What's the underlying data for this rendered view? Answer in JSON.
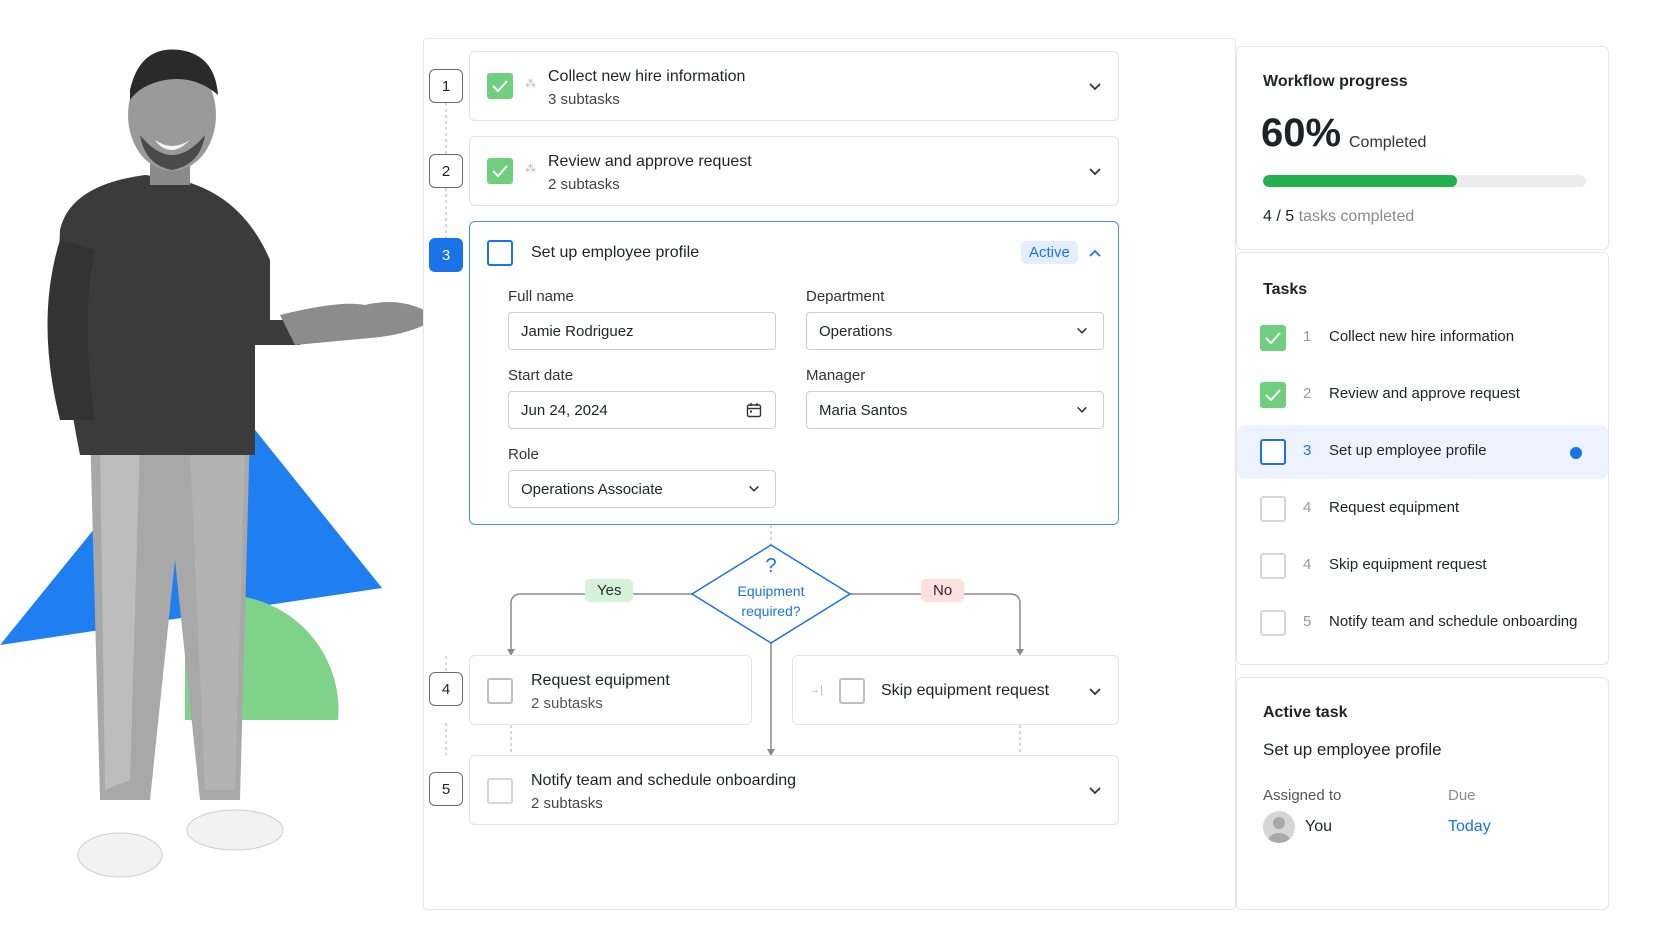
{
  "workflow": {
    "steps": [
      {
        "num": "1",
        "title": "Collect new hire information",
        "subtitle": "3 subtasks",
        "status": "done"
      },
      {
        "num": "2",
        "title": "Review and approve request",
        "subtitle": "2 subtasks",
        "status": "done"
      },
      {
        "num": "3",
        "title": "Set up employee profile",
        "badge": "Active",
        "status": "active"
      },
      {
        "num": "4",
        "title": "Request equipment",
        "subtitle": "2 subtasks",
        "status": "todo"
      },
      {
        "num": "5",
        "title": "Notify team and schedule onboarding",
        "subtitle": "2 subtasks",
        "status": "todo"
      }
    ],
    "skip_step": {
      "title": "Skip equipment request"
    },
    "form": {
      "full_name_label": "Full name",
      "full_name_value": "Jamie Rodriguez",
      "department_label": "Department",
      "department_value": "Operations",
      "start_date_label": "Start date",
      "start_date_value": "Jun 24, 2024",
      "manager_label": "Manager",
      "manager_value": "Maria Santos",
      "role_label": "Role",
      "role_value": "Operations Associate"
    },
    "decision": {
      "symbol": "?",
      "line1": "Equipment",
      "line2": "required?",
      "yes": "Yes",
      "no": "No"
    }
  },
  "progress": {
    "title": "Workflow progress",
    "percent_text": "60%",
    "percent_label": "Completed",
    "percent_value": 0.6,
    "completed": "4",
    "total": "5",
    "count_sep": "/",
    "count_suffix": "tasks completed"
  },
  "tasks": {
    "title": "Tasks",
    "items": [
      {
        "num": "1",
        "label": "Collect new hire information",
        "status": "done"
      },
      {
        "num": "2",
        "label": "Review and approve request",
        "status": "done"
      },
      {
        "num": "3",
        "label": "Set up employee profile",
        "status": "active"
      },
      {
        "num": "4",
        "label": "Request equipment",
        "status": "todo"
      },
      {
        "num": "4",
        "label": "Skip equipment request",
        "status": "todo"
      },
      {
        "num": "5",
        "label": "Notify team and schedule onboarding",
        "status": "todo"
      }
    ]
  },
  "active_task": {
    "title": "Active task",
    "name": "Set up employee profile",
    "assigned_label": "Assigned to",
    "assigned_value": "You",
    "due_label": "Due",
    "due_value": "Today"
  },
  "colors": {
    "accent": "#1a73e8",
    "success": "#22b14c",
    "check_done": "#6fcf7f",
    "decor_blue": "#1f7ff0",
    "decor_green": "#7ed389"
  }
}
